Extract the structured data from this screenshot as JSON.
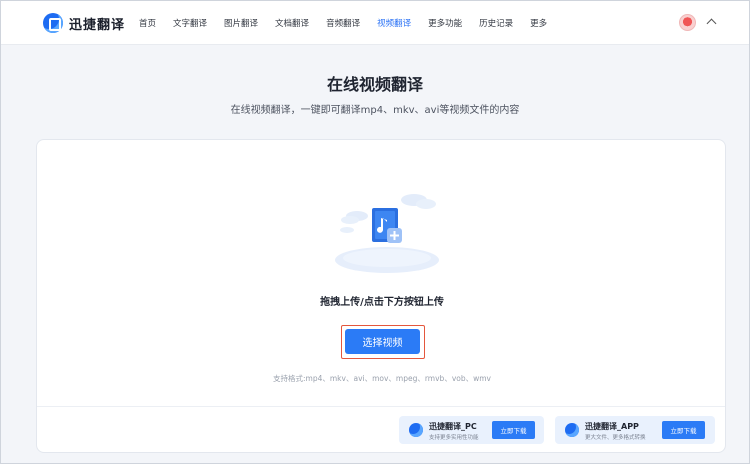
{
  "brand": {
    "name": "迅捷翻译"
  },
  "nav": {
    "items": [
      {
        "label": "首页"
      },
      {
        "label": "文字翻译"
      },
      {
        "label": "图片翻译"
      },
      {
        "label": "文档翻译"
      },
      {
        "label": "音频翻译"
      },
      {
        "label": "视频翻译",
        "active": true
      },
      {
        "label": "更多功能"
      },
      {
        "label": "历史记录"
      },
      {
        "label": "更多"
      }
    ]
  },
  "page": {
    "title": "在线视频翻译",
    "subtitle": "在线视频翻译，一键即可翻译mp4、mkv、avi等视频文件的内容"
  },
  "upload": {
    "drop_text": "拖拽上传/点击下方按钮上传",
    "button_label": "选择视频",
    "formats": "支持格式:mp4、mkv、avi、mov、mpeg、rmvb、vob、wmv"
  },
  "promos": [
    {
      "title": "迅捷翻译_PC",
      "subtitle": "支持更多实用性功能",
      "button": "立即下载"
    },
    {
      "title": "迅捷翻译_APP",
      "subtitle": "更大文件、更多格式转换",
      "button": "立即下载"
    }
  ],
  "colors": {
    "accent": "#2b7bf6",
    "highlight_border": "#e4573d",
    "background": "#f3f5f9"
  }
}
